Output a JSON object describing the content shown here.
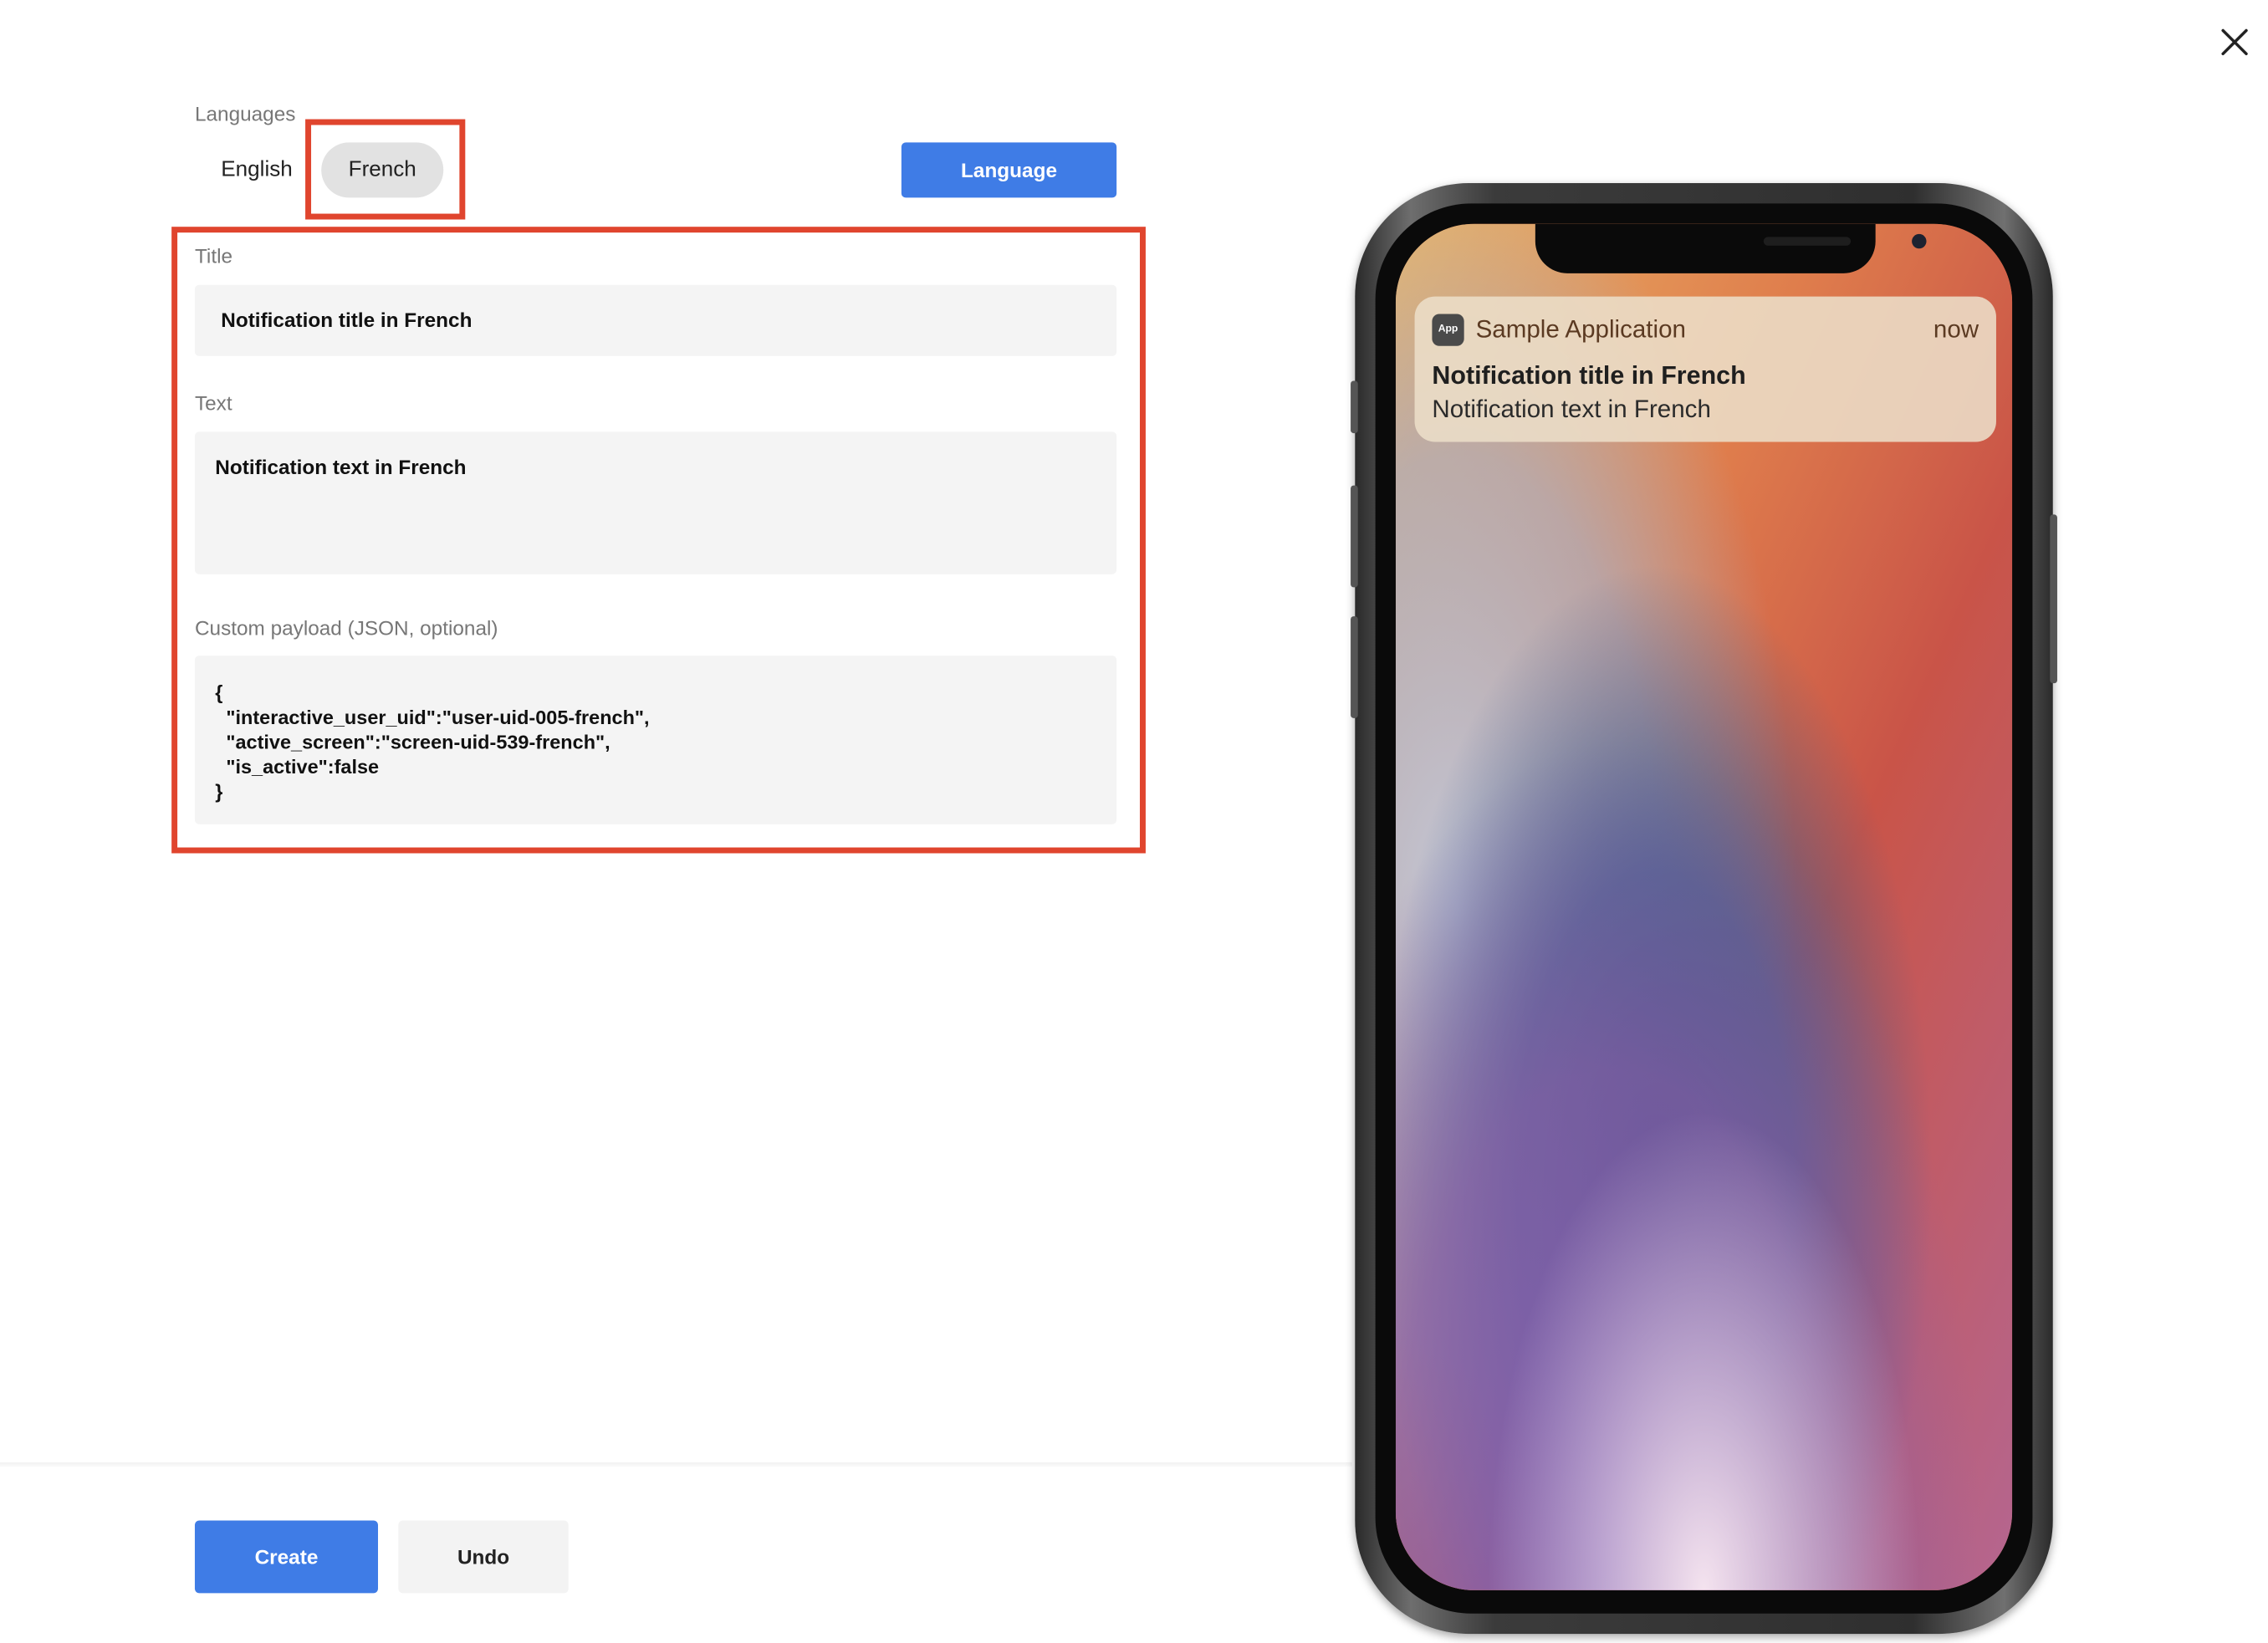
{
  "languages": {
    "label": "Languages",
    "tabs": [
      {
        "label": "English",
        "selected": false
      },
      {
        "label": "French",
        "selected": true
      }
    ],
    "add_button_label": "Language"
  },
  "form": {
    "title": {
      "label": "Title",
      "value": "Notification title in French"
    },
    "text": {
      "label": "Text",
      "value": "Notification text in French"
    },
    "payload": {
      "label": "Custom payload (JSON, optional)",
      "lines": [
        "{",
        "  \"interactive_user_uid\":\"user-uid-005-french\",",
        "  \"active_screen\":\"screen-uid-539-french\",",
        "  \"is_active\":false",
        "}"
      ]
    }
  },
  "actions": {
    "create_label": "Create",
    "undo_label": "Undo"
  },
  "preview": {
    "app_icon_text": "App",
    "app_name": "Sample Application",
    "time": "now",
    "title": "Notification title in French",
    "body": "Notification text in French"
  },
  "colors": {
    "primary": "#3f7ce6",
    "highlight": "#e0452e",
    "field_bg": "#f4f4f4",
    "selected_tab_bg": "#e2e2e2"
  },
  "icons": {
    "close": "close-icon",
    "app": "app-icon"
  }
}
